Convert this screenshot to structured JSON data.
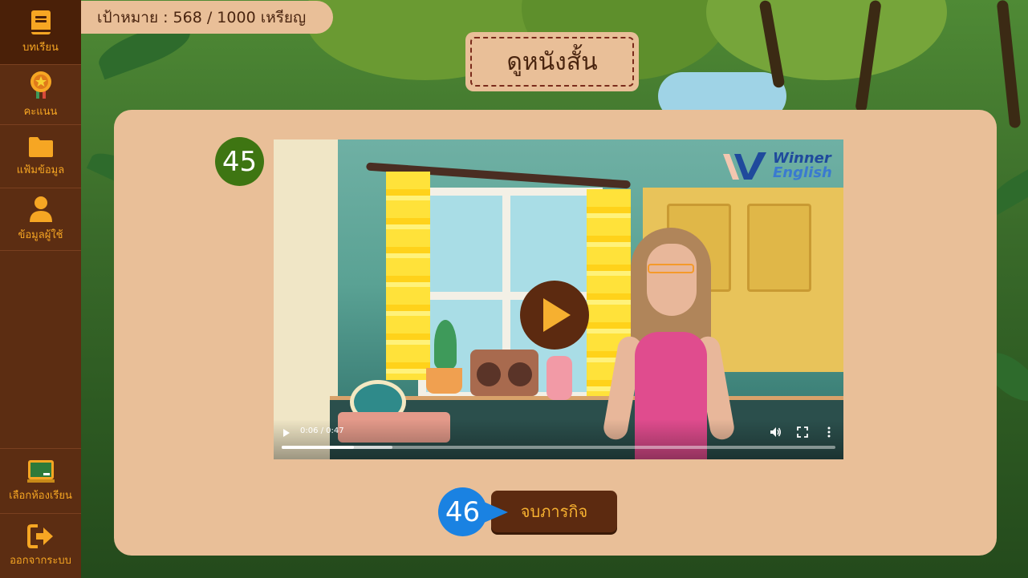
{
  "sidebar": {
    "items": [
      {
        "label": "บทเรียน",
        "icon": "book-icon"
      },
      {
        "label": "คะแนน",
        "icon": "medal-icon"
      },
      {
        "label": "แฟ้มข้อมูล",
        "icon": "folder-icon"
      },
      {
        "label": "ข้อมูลผู้ใช้",
        "icon": "user-icon"
      }
    ],
    "bottom_items": [
      {
        "label": "เลือกห้องเรียน",
        "icon": "chalkboard-icon"
      },
      {
        "label": "ออกจากระบบ",
        "icon": "logout-icon"
      }
    ],
    "active_index": 0
  },
  "goal": {
    "text": "เป้าหมาย : 568 / 1000 เหรียญ"
  },
  "title": "ดูหนังสั้น",
  "step_badges": {
    "video": "45",
    "finish": "46"
  },
  "video": {
    "brand_line1": "Winner",
    "brand_line2": "English",
    "time": "0:06 / 0:47",
    "progress": 0.13,
    "buffered": 0.2
  },
  "finish_button": {
    "label": "จบภารกิจ"
  },
  "colors": {
    "sidebar_bg": "#5c2d12",
    "sidebar_accent": "#f6a623",
    "panel_bg": "#e9bf98",
    "button_bg": "#5c2a10",
    "badge_green": "#3e7512",
    "badge_blue": "#1a82e2"
  }
}
